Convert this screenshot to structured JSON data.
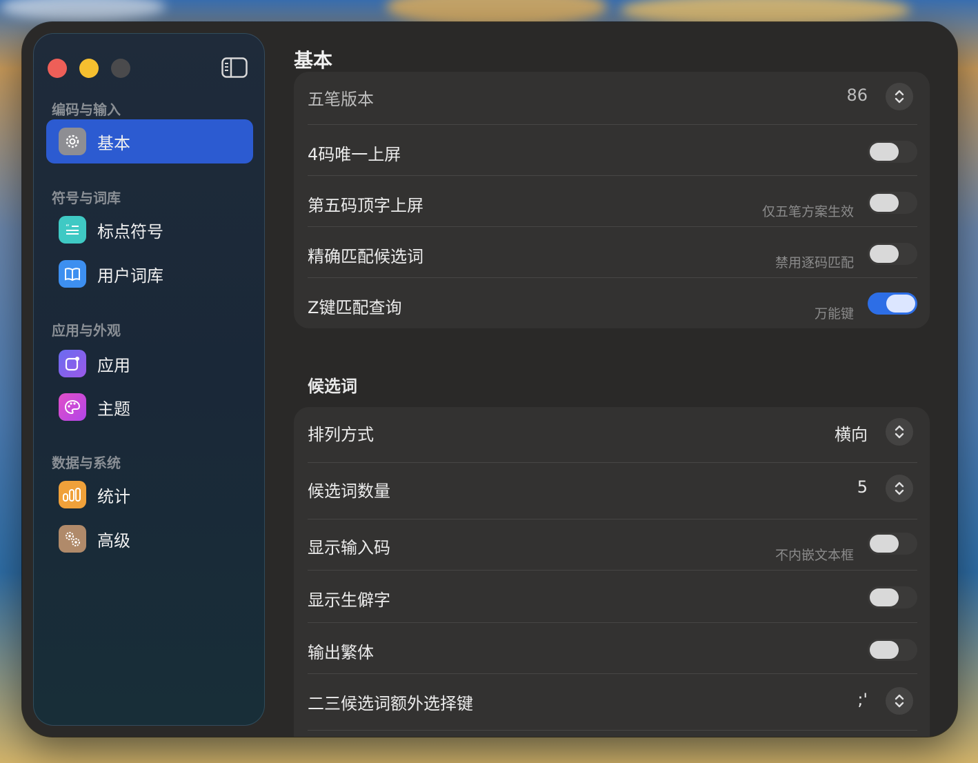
{
  "sidebar": {
    "groups": [
      {
        "label": "编码与输入"
      },
      {
        "label": "符号与词库"
      },
      {
        "label": "应用与外观"
      },
      {
        "label": "数据与系统"
      }
    ],
    "items": [
      {
        "label": "基本",
        "icon": "gear-icon",
        "active": true
      },
      {
        "label": "标点符号",
        "icon": "quote-icon"
      },
      {
        "label": "用户词库",
        "icon": "book-icon"
      },
      {
        "label": "应用",
        "icon": "app-icon"
      },
      {
        "label": "主题",
        "icon": "palette-icon"
      },
      {
        "label": "统计",
        "icon": "bar-chart-icon"
      },
      {
        "label": "高级",
        "icon": "gears-icon"
      }
    ]
  },
  "main": {
    "title": "基本",
    "card1": {
      "rows": [
        {
          "label": "五笔版本",
          "value": "86",
          "control": "stepper"
        },
        {
          "label": "4码唯一上屏",
          "control": "toggle",
          "on": false
        },
        {
          "label": "第五码顶字上屏",
          "sub": "仅五笔方案生效",
          "control": "toggle",
          "on": false
        },
        {
          "label": "精确匹配候选词",
          "sub": "禁用逐码匹配",
          "control": "toggle",
          "on": false
        },
        {
          "label": "Z键匹配查询",
          "sub": "万能键",
          "control": "toggle",
          "on": true
        }
      ]
    },
    "section2_title": "候选词",
    "card2": {
      "rows": [
        {
          "label": "排列方式",
          "value": "横向",
          "control": "stepper"
        },
        {
          "label": "候选词数量",
          "value": "5",
          "control": "stepper"
        },
        {
          "label": "显示输入码",
          "sub": "不内嵌文本框",
          "control": "toggle",
          "on": false
        },
        {
          "label": "显示生僻字",
          "control": "toggle",
          "on": false
        },
        {
          "label": "输出繁体",
          "control": "toggle",
          "on": false
        },
        {
          "label": "二三候选词额外选择键",
          "value": ";'",
          "control": "stepper"
        }
      ]
    }
  },
  "colors": {
    "accent": "#2c5bd1",
    "toggle_on": "#2d6ee6",
    "window_bg": "#2a2928",
    "card_bg": "#333231"
  }
}
